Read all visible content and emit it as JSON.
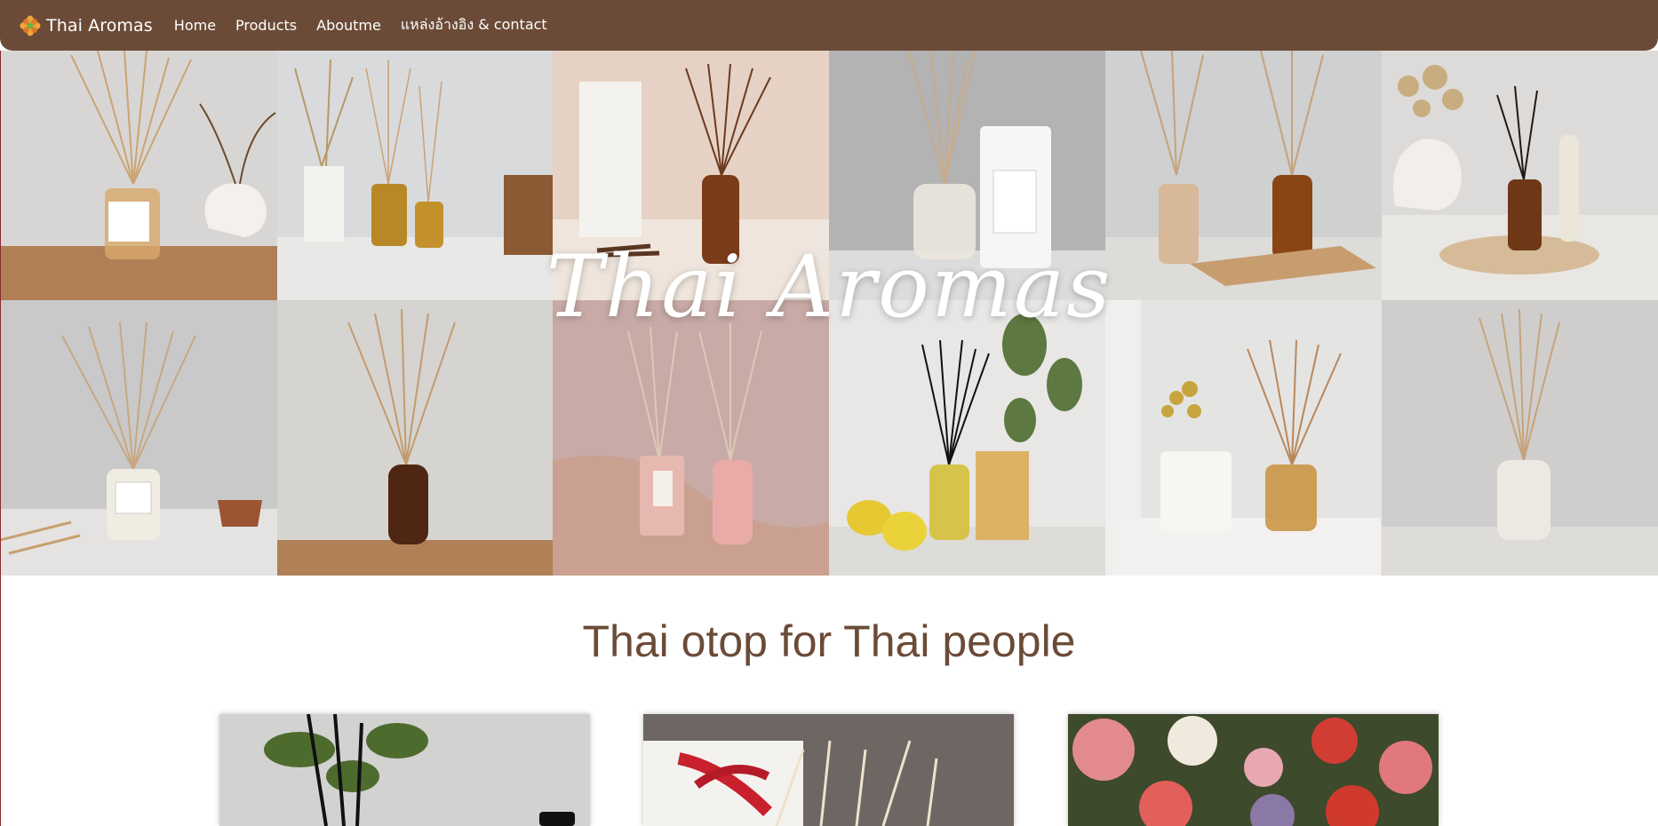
{
  "navbar": {
    "brand_name": "Thai Aromas",
    "brand_icon": "flower-logo-icon",
    "links": [
      "Home",
      "Products",
      "Aboutme",
      "แหล่งอ้างอิง & contact"
    ],
    "background": "#6b4b37"
  },
  "hero": {
    "title": "Thai Aromas",
    "tiles": [
      "reed-diffuser-photo-1",
      "reed-diffuser-photo-2",
      "reed-diffuser-photo-3",
      "reed-diffuser-photo-4",
      "reed-diffuser-photo-5",
      "reed-diffuser-photo-6",
      "reed-diffuser-photo-7",
      "reed-diffuser-photo-8",
      "reed-diffuser-photo-9",
      "reed-diffuser-photo-10",
      "reed-diffuser-photo-11",
      "reed-diffuser-photo-12"
    ]
  },
  "section": {
    "heading": "Thai otop for Thai people",
    "heading_color": "#6b4b37",
    "cards": [
      "black-reed-diffuser-card",
      "gift-box-card",
      "floral-pattern-card"
    ]
  }
}
